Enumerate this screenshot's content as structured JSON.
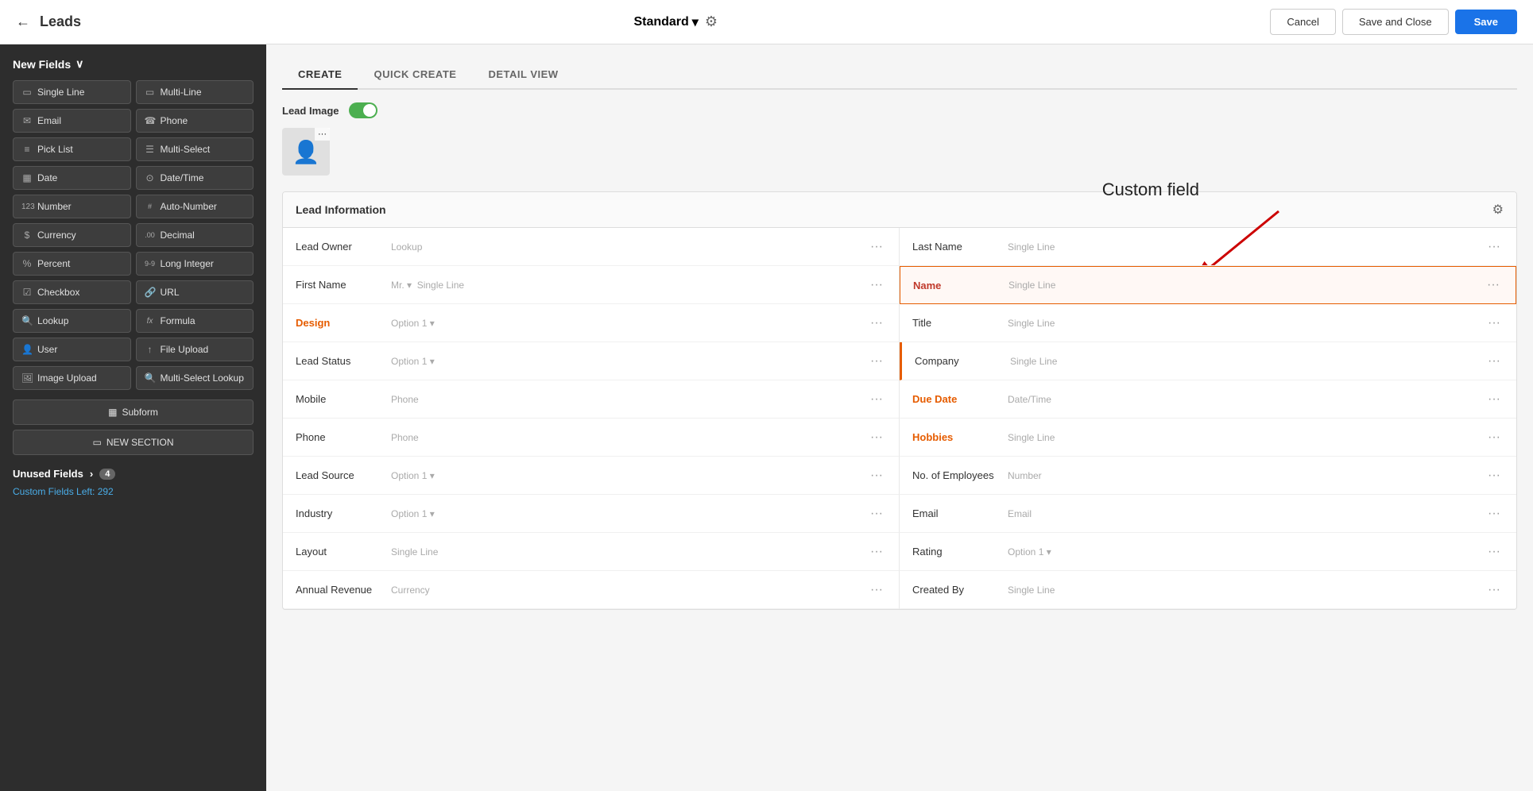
{
  "header": {
    "back_label": "←",
    "title": "Leads",
    "standard_label": "Standard",
    "dropdown_arrow": "▾",
    "cancel_label": "Cancel",
    "save_close_label": "Save and Close",
    "save_label": "Save"
  },
  "sidebar": {
    "new_fields_label": "New Fields",
    "new_fields_arrow": "∨",
    "fields": [
      {
        "icon": "▭",
        "label": "Single Line"
      },
      {
        "icon": "▭",
        "label": "Multi-Line"
      },
      {
        "icon": "✉",
        "label": "Email"
      },
      {
        "icon": "☎",
        "label": "Phone"
      },
      {
        "icon": "≡",
        "label": "Pick List"
      },
      {
        "icon": "☰",
        "label": "Multi-Select"
      },
      {
        "icon": "📅",
        "label": "Date"
      },
      {
        "icon": "🕐",
        "label": "Date/Time"
      },
      {
        "icon": "123",
        "label": "Number"
      },
      {
        "icon": "##",
        "label": "Auto-Number"
      },
      {
        "icon": "$",
        "label": "Currency"
      },
      {
        "icon": ".00",
        "label": "Decimal"
      },
      {
        "icon": "%",
        "label": "Percent"
      },
      {
        "icon": "9-9",
        "label": "Long Integer"
      },
      {
        "icon": "☑",
        "label": "Checkbox"
      },
      {
        "icon": "🔗",
        "label": "URL"
      },
      {
        "icon": "🔍",
        "label": "Lookup"
      },
      {
        "icon": "fx",
        "label": "Formula"
      },
      {
        "icon": "👤",
        "label": "User"
      },
      {
        "icon": "↑",
        "label": "File Upload"
      },
      {
        "icon": "🖼",
        "label": "Image Upload"
      },
      {
        "icon": "🔍",
        "label": "Multi-Select Lookup"
      }
    ],
    "subform_label": "Subform",
    "new_section_label": "NEW SECTION",
    "unused_fields_label": "Unused Fields",
    "unused_fields_arrow": "›",
    "unused_count": "4",
    "custom_fields_label": "Custom Fields Left: 292"
  },
  "tabs": [
    {
      "label": "CREATE",
      "active": true
    },
    {
      "label": "QUICK CREATE",
      "active": false
    },
    {
      "label": "DETAIL VIEW",
      "active": false
    }
  ],
  "lead_image": {
    "label": "Lead Image",
    "toggle_on": true
  },
  "annotation": {
    "text": "Custom field",
    "arrow_color": "#cc0000"
  },
  "section": {
    "title": "Lead Information",
    "gear_icon": "⚙"
  },
  "fields_left": [
    {
      "label": "Lead Owner",
      "type": "Lookup",
      "custom": false
    },
    {
      "label": "First Name",
      "type": "Mr. ▾  Single Line",
      "custom": false
    },
    {
      "label": "Design",
      "type": "Option 1 ▾",
      "custom": true
    },
    {
      "label": "Lead Status",
      "type": "Option 1 ▾",
      "custom": false
    },
    {
      "label": "Mobile",
      "type": "Phone",
      "custom": false
    },
    {
      "label": "Phone",
      "type": "Phone",
      "custom": false
    },
    {
      "label": "Lead Source",
      "type": "Option 1 ▾",
      "custom": false
    },
    {
      "label": "Industry",
      "type": "Option 1 ▾",
      "custom": false
    },
    {
      "label": "Layout",
      "type": "Single Line",
      "custom": false
    },
    {
      "label": "Annual Revenue",
      "type": "Currency",
      "custom": false
    }
  ],
  "fields_right": [
    {
      "label": "Last Name",
      "type": "Single Line",
      "custom": false,
      "highlight": false
    },
    {
      "label": "Name",
      "type": "Single Line",
      "custom": false,
      "highlight": true,
      "name_field": true
    },
    {
      "label": "Title",
      "type": "Single Line",
      "custom": false,
      "highlight": false
    },
    {
      "label": "Company",
      "type": "Single Line",
      "custom": false,
      "highlight": true,
      "company": true
    },
    {
      "label": "Due Date",
      "type": "Date/Time",
      "custom": true,
      "highlight": false
    },
    {
      "label": "Hobbies",
      "type": "Single Line",
      "custom": true,
      "highlight": false
    },
    {
      "label": "No. of Employees",
      "type": "Number",
      "custom": false,
      "highlight": false
    },
    {
      "label": "Email",
      "type": "Email",
      "custom": false,
      "highlight": false
    },
    {
      "label": "Rating",
      "type": "Option 1 ▾",
      "custom": false,
      "highlight": false
    },
    {
      "label": "Created By",
      "type": "Single Line",
      "custom": false,
      "highlight": false
    }
  ]
}
